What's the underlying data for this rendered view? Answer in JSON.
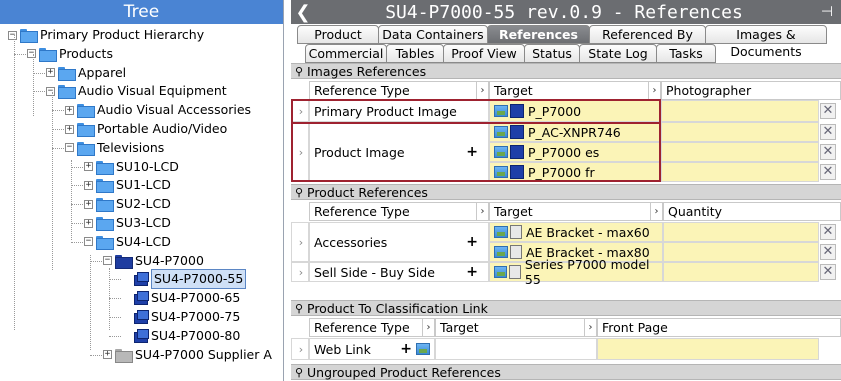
{
  "tree": {
    "title": "Tree",
    "nodes": [
      {
        "label": "Primary Product Hierarchy",
        "toggle": "−",
        "kind": "folder"
      },
      {
        "label": "Products",
        "toggle": "−",
        "kind": "folder"
      },
      {
        "label": "Apparel",
        "toggle": "+",
        "kind": "folder"
      },
      {
        "label": "Audio Visual Equipment",
        "toggle": "−",
        "kind": "folder"
      },
      {
        "label": "Audio Visual Accessories",
        "toggle": "+",
        "kind": "folder"
      },
      {
        "label": "Portable Audio/Video",
        "toggle": "+",
        "kind": "folder"
      },
      {
        "label": "Televisions",
        "toggle": "−",
        "kind": "folder"
      },
      {
        "label": "SU10-LCD",
        "toggle": "+",
        "kind": "folder"
      },
      {
        "label": "SU1-LCD",
        "toggle": "+",
        "kind": "folder"
      },
      {
        "label": "SU2-LCD",
        "toggle": "+",
        "kind": "folder"
      },
      {
        "label": "SU3-LCD",
        "toggle": "+",
        "kind": "folder"
      },
      {
        "label": "SU4-LCD",
        "toggle": "−",
        "kind": "folder"
      },
      {
        "label": "SU4-P7000",
        "toggle": "−",
        "kind": "folder-dark"
      },
      {
        "label": "SU4-P7000-55",
        "toggle": "",
        "kind": "product",
        "selected": true
      },
      {
        "label": "SU4-P7000-65",
        "toggle": "",
        "kind": "product"
      },
      {
        "label": "SU4-P7000-75",
        "toggle": "",
        "kind": "product"
      },
      {
        "label": "SU4-P7000-80",
        "toggle": "",
        "kind": "product"
      },
      {
        "label": "SU4-P7000 Supplier A",
        "toggle": "+",
        "kind": "folder-gray"
      }
    ]
  },
  "header": {
    "back": "❮",
    "title": "SU4-P7000-55 rev.0.9 - References",
    "pin": "⊣"
  },
  "tabs_row1": [
    "Product",
    "Data Containers",
    "References",
    "Referenced By",
    "Images & Documents"
  ],
  "tabs_row2": [
    "Commercial",
    "Tables",
    "Proof View",
    "Status",
    "State Log",
    "Tasks"
  ],
  "sections": {
    "images": {
      "title": "Images References",
      "cols": [
        "Reference Type",
        "Target",
        "Photographer"
      ],
      "rows": [
        {
          "type": "Primary Product Image",
          "targets": [
            "P_P7000"
          ]
        },
        {
          "type": "Product Image",
          "targets": [
            "P_AC-XNPR746",
            "P_P7000 es",
            "P_P7000 fr"
          ]
        }
      ]
    },
    "product": {
      "title": "Product References",
      "cols": [
        "Reference Type",
        "Target",
        "Quantity"
      ],
      "rows": [
        {
          "type": "Accessories",
          "targets": [
            "AE Bracket - max60",
            "AE Bracket - max80"
          ]
        },
        {
          "type": "Sell Side - Buy Side",
          "targets": [
            "Series P7000 model 55"
          ]
        }
      ]
    },
    "classification": {
      "title": "Product To Classification Link",
      "cols": [
        "Reference Type",
        "Target",
        "Front Page"
      ],
      "rows": [
        {
          "type": "Web Link",
          "targets": []
        }
      ]
    },
    "ungrouped": {
      "title": "Ungrouped Product References"
    }
  },
  "symbols": {
    "plus": "+",
    "remove": "✕",
    "row_arrow": "›",
    "col_arrow": "›",
    "pin_icon": "⚲"
  },
  "colors": {
    "tree_title_bg": "#4a84d3",
    "header_bg": "#6b6d71",
    "highlight_box": "#9e2230",
    "editable_cell": "#fbf4b7"
  }
}
